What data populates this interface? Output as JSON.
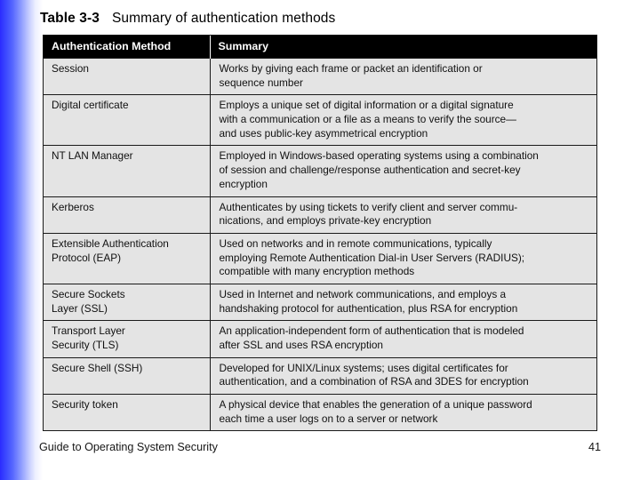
{
  "caption": {
    "label": "Table 3-3",
    "text": "Summary of authentication methods"
  },
  "table": {
    "columns": [
      {
        "key": "method",
        "header": "Authentication Method"
      },
      {
        "key": "summary",
        "header": "Summary"
      }
    ],
    "rows": [
      {
        "method_lines": [
          "Session"
        ],
        "summary_lines": [
          "Works by giving each frame or packet an identification or",
          "sequence number"
        ]
      },
      {
        "method_lines": [
          "Digital certificate"
        ],
        "summary_lines": [
          "Employs a unique set of digital information or a digital signature",
          "with a communication or a file as a means to verify the source—",
          "and uses public-key asymmetrical encryption"
        ]
      },
      {
        "method_lines": [
          "NT LAN Manager"
        ],
        "summary_lines": [
          "Employed in Windows-based operating systems using a combination",
          "of session and challenge/response authentication and secret-key",
          "encryption"
        ]
      },
      {
        "method_lines": [
          "Kerberos"
        ],
        "summary_lines": [
          "Authenticates by using tickets to verify client and server commu-",
          "nications, and employs private-key encryption"
        ]
      },
      {
        "method_lines": [
          "Extensible Authentication",
          "Protocol (EAP)"
        ],
        "summary_lines": [
          "Used on networks and in remote communications, typically",
          "employing Remote Authentication Dial-in User Servers (RADIUS);",
          "compatible with many encryption methods"
        ]
      },
      {
        "method_lines": [
          "Secure Sockets",
          "Layer (SSL)"
        ],
        "summary_lines": [
          "Used in Internet and network communications, and employs a",
          "handshaking protocol for authentication, plus RSA for encryption"
        ]
      },
      {
        "method_lines": [
          "Transport Layer",
          "Security (TLS)"
        ],
        "summary_lines": [
          "An application-independent form of authentication that is modeled",
          "after SSL and uses RSA encryption"
        ]
      },
      {
        "method_lines": [
          "Secure Shell (SSH)"
        ],
        "summary_lines": [
          "Developed for UNIX/Linux systems; uses digital certificates for",
          "authentication, and a combination of RSA and 3DES for encryption"
        ]
      },
      {
        "method_lines": [
          "Security token"
        ],
        "summary_lines": [
          "A physical device that enables the generation of a unique password",
          "each time a user logs on to a server or network"
        ]
      }
    ]
  },
  "footer": {
    "title": "Guide to Operating System Security",
    "page": "41"
  },
  "colors": {
    "header_bg": "#000000",
    "header_text": "#ffffff",
    "cell_bg": "#e4e4e4",
    "border": "#1a1a1a",
    "accent_blue": "#2b2bff",
    "slide_bg": "#ffffff"
  }
}
